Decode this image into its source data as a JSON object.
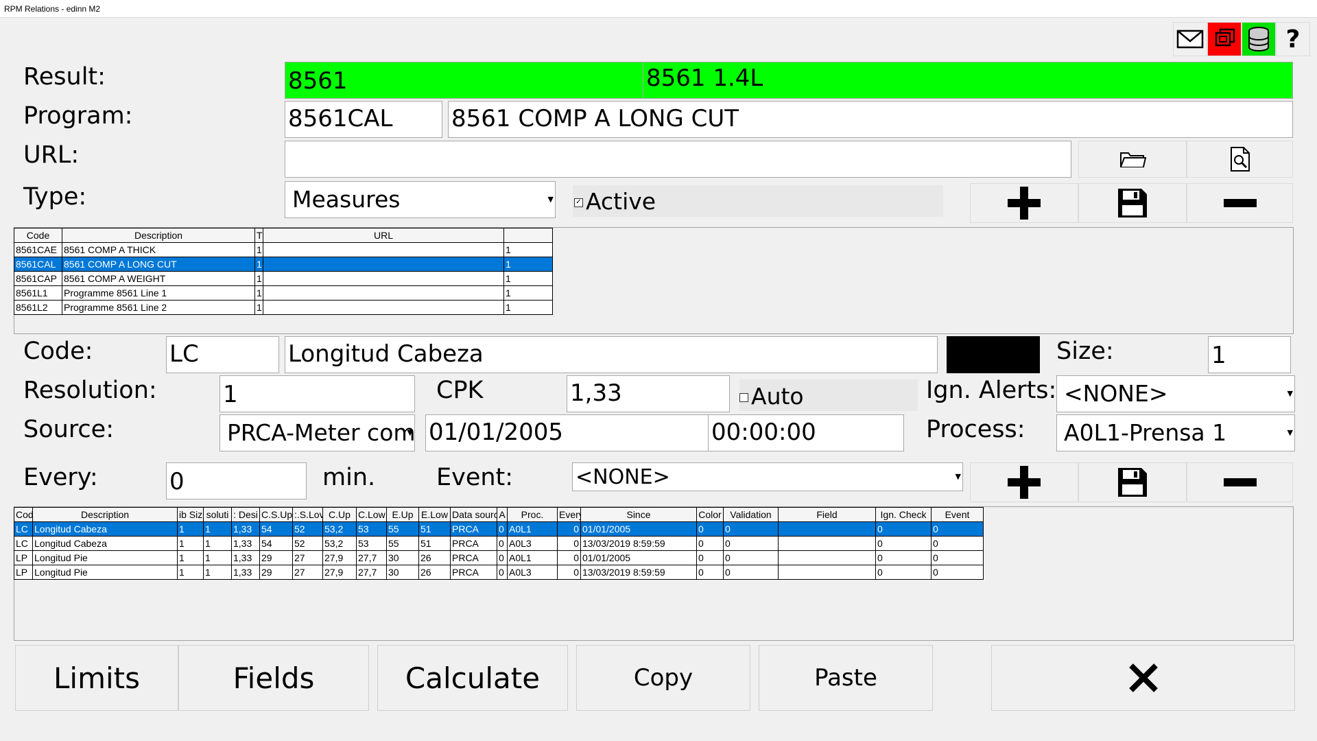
{
  "window": {
    "title": "RPM Relations - edinn M2"
  },
  "toolbar": {
    "icons": [
      "mail-icon",
      "windows-icon",
      "database-icon",
      "help-icon"
    ],
    "help_label": "?"
  },
  "labels": {
    "result": "Result:",
    "program": "Program:",
    "url": "URL:",
    "type": "Type:",
    "code": "Code:",
    "size": "Size:",
    "resolution": "Resolution:",
    "cpk": "CPK",
    "ign_alerts": "Ign. Alerts:",
    "source": "Source:",
    "process": "Process:",
    "every": "Every:",
    "min": "min.",
    "event": "Event:",
    "active": "Active",
    "auto": "Auto"
  },
  "fields": {
    "result_code": "8561",
    "result_desc": "8561 1.4L",
    "program_code": "8561CAL",
    "program_desc": "8561 COMP A LONG CUT",
    "url": "",
    "type": "Measures",
    "active": true,
    "code": "LC",
    "code_desc": "Longitud Cabeza",
    "code_color": "#000000",
    "size": "1",
    "resolution": "1",
    "cpk": "1,33",
    "auto": false,
    "ign_alerts": "<NONE>",
    "source": "PRCA-Meter comp",
    "date": "01/01/2005",
    "time": "00:00:00",
    "process": "A0L1-Prensa 1",
    "every": "0",
    "event": "<NONE>"
  },
  "colors": {
    "result_bg": "#00ff00",
    "selected_row": "#0078d7",
    "windows_icon_bg": "#ff0000",
    "database_icon_bg": "#00e000"
  },
  "programs_table": {
    "headers": [
      "Code",
      "Description",
      "T",
      "URL",
      ""
    ],
    "rows": [
      [
        "8561CAE",
        "8561 COMP A THICK",
        "1",
        "",
        "1"
      ],
      [
        "8561CAL",
        "8561 COMP A LONG CUT",
        "1",
        "",
        "1"
      ],
      [
        "8561CAP",
        "8561 COMP A WEIGHT",
        "1",
        "",
        "1"
      ],
      [
        "8561L1",
        "Programme 8561 Line 1",
        "1",
        "",
        "1"
      ],
      [
        "8561L2",
        "Programme 8561 Line 2",
        "1",
        "",
        "1"
      ]
    ],
    "selected": 1
  },
  "measures_table": {
    "headers": [
      "Code",
      "Description",
      "Sub Size",
      "Resolution",
      "Desired",
      "C.S.Up",
      "C.S.Low",
      "C.Up",
      "C.Low",
      "E.Up",
      "E.Low",
      "Data source",
      "A",
      "Proc.",
      "Every",
      "Since",
      "Color",
      "Validation",
      "Field",
      "Ign. Check",
      "Event"
    ],
    "header_display": [
      "Cod",
      "Description",
      "ib Siz",
      "soluti",
      ": Desi",
      "C.S.Up",
      ":.S.Lov",
      "C.Up",
      "C.Low",
      "E.Up",
      "E.Low",
      "Data sourc",
      "A",
      "Proc.",
      "Every",
      "Since",
      "Color",
      "Validation",
      "Field",
      "Ign. Check",
      "Event"
    ],
    "rows": [
      [
        "LC",
        "Longitud Cabeza",
        "1",
        "1",
        "1,33",
        "54",
        "52",
        "53,2",
        "53",
        "55",
        "51",
        "PRCA",
        "0",
        "A0L1",
        "0",
        "01/01/2005",
        "0",
        "0",
        "",
        "0",
        "0"
      ],
      [
        "LC",
        "Longitud Cabeza",
        "1",
        "1",
        "1,33",
        "54",
        "52",
        "53,2",
        "53",
        "55",
        "51",
        "PRCA",
        "0",
        "A0L3",
        "0",
        "13/03/2019 8:59:59",
        "0",
        "0",
        "",
        "0",
        "0"
      ],
      [
        "LP",
        "Longitud Pie",
        "1",
        "1",
        "1,33",
        "29",
        "27",
        "27,9",
        "27,7",
        "30",
        "26",
        "PRCA",
        "0",
        "A0L1",
        "0",
        "01/01/2005",
        "0",
        "0",
        "",
        "0",
        "0"
      ],
      [
        "LP",
        "Longitud Pie",
        "1",
        "1",
        "1,33",
        "29",
        "27",
        "27,9",
        "27,7",
        "30",
        "26",
        "PRCA",
        "0",
        "A0L3",
        "0",
        "13/03/2019 8:59:59",
        "0",
        "0",
        "",
        "0",
        "0"
      ]
    ],
    "selected": 0
  },
  "bottom_buttons": {
    "limits": "Limits",
    "fields": "Fields",
    "calculate": "Calculate",
    "copy": "Copy",
    "paste": "Paste",
    "close_icon": "close-icon"
  }
}
